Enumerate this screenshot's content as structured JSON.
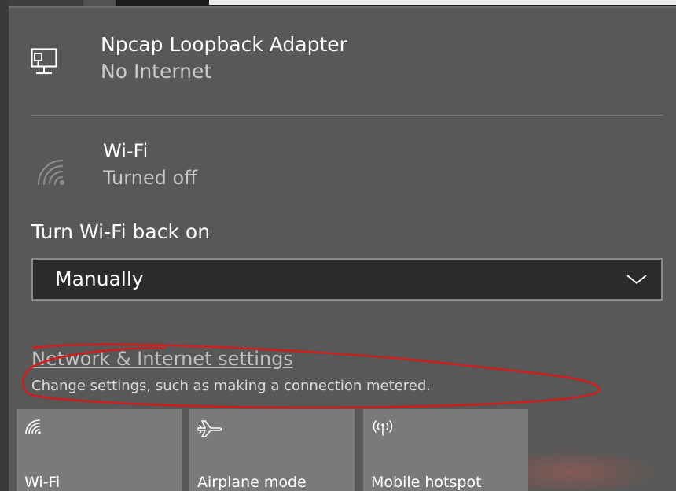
{
  "networks": [
    {
      "name": "Npcap Loopback Adapter",
      "status": "No Internet",
      "icon": "ethernet-icon"
    },
    {
      "name": "Wi-Fi",
      "status": "Turned off",
      "icon": "wifi-off-icon"
    }
  ],
  "wifi_schedule": {
    "label": "Turn Wi-Fi back on",
    "selected": "Manually"
  },
  "settings": {
    "link": "Network & Internet settings",
    "description": "Change settings, such as making a connection metered."
  },
  "quick_actions": [
    {
      "label": "Wi-Fi",
      "icon": "wifi-icon"
    },
    {
      "label": "Airplane mode",
      "icon": "airplane-icon"
    },
    {
      "label": "Mobile hotspot",
      "icon": "hotspot-icon"
    }
  ],
  "colors": {
    "panel_background": "#585858",
    "tile_background": "#7a7a7a",
    "annotation": "#d41c1c"
  }
}
